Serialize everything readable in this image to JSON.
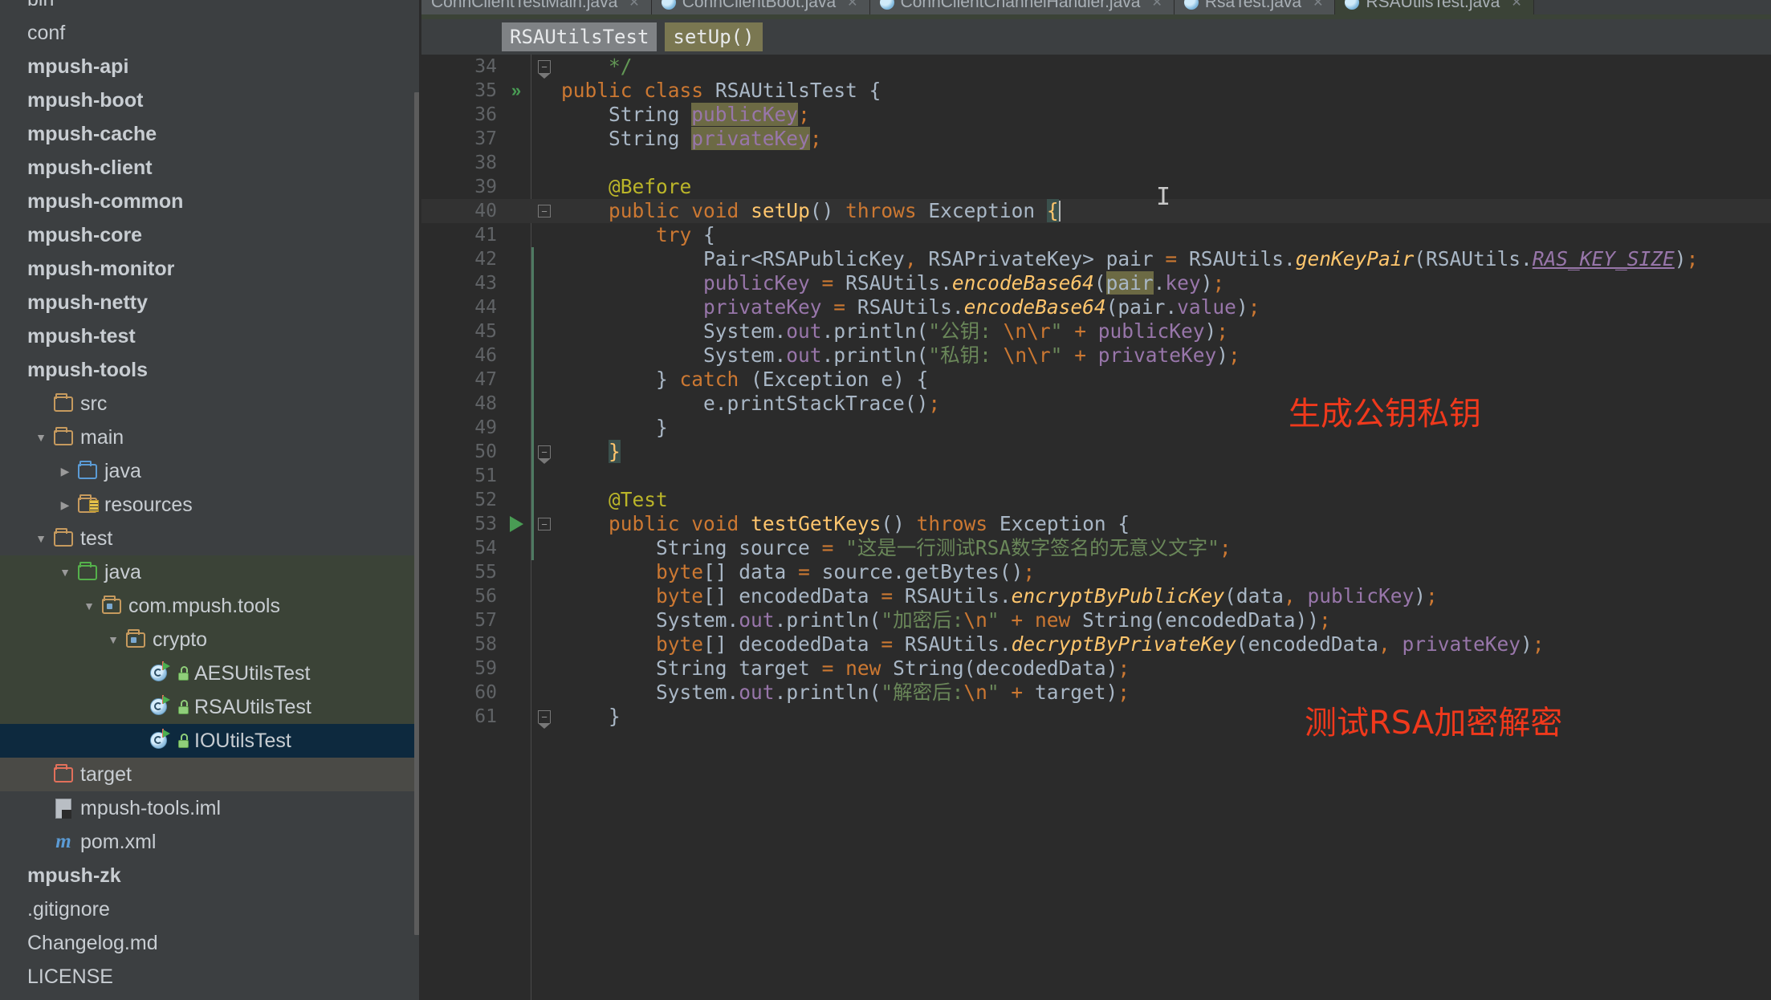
{
  "sidebar": {
    "items": [
      {
        "label": "bin",
        "indent": 0,
        "bold": false,
        "icon": "none",
        "twisty": "none",
        "sel": "none"
      },
      {
        "label": "conf",
        "indent": 0,
        "bold": false,
        "icon": "none",
        "twisty": "none",
        "sel": "none"
      },
      {
        "label": "mpush-api",
        "indent": 0,
        "bold": true,
        "icon": "none",
        "twisty": "none",
        "sel": "none"
      },
      {
        "label": "mpush-boot",
        "indent": 0,
        "bold": true,
        "icon": "none",
        "twisty": "none",
        "sel": "none"
      },
      {
        "label": "mpush-cache",
        "indent": 0,
        "bold": true,
        "icon": "none",
        "twisty": "none",
        "sel": "none"
      },
      {
        "label": "mpush-client",
        "indent": 0,
        "bold": true,
        "icon": "none",
        "twisty": "none",
        "sel": "none"
      },
      {
        "label": "mpush-common",
        "indent": 0,
        "bold": true,
        "icon": "none",
        "twisty": "none",
        "sel": "none"
      },
      {
        "label": "mpush-core",
        "indent": 0,
        "bold": true,
        "icon": "none",
        "twisty": "none",
        "sel": "none"
      },
      {
        "label": "mpush-monitor",
        "indent": 0,
        "bold": true,
        "icon": "none",
        "twisty": "none",
        "sel": "none"
      },
      {
        "label": "mpush-netty",
        "indent": 0,
        "bold": true,
        "icon": "none",
        "twisty": "none",
        "sel": "none"
      },
      {
        "label": "mpush-test",
        "indent": 0,
        "bold": true,
        "icon": "none",
        "twisty": "none",
        "sel": "none"
      },
      {
        "label": "mpush-tools",
        "indent": 0,
        "bold": true,
        "icon": "none",
        "twisty": "none",
        "sel": "none"
      },
      {
        "label": "src",
        "indent": 1,
        "bold": false,
        "icon": "folder",
        "twisty": "none",
        "sel": "none"
      },
      {
        "label": "main",
        "indent": 1,
        "bold": false,
        "icon": "folder",
        "twisty": "down",
        "sel": "none"
      },
      {
        "label": "java",
        "indent": 2,
        "bold": false,
        "icon": "folder-blue",
        "twisty": "right",
        "sel": "none"
      },
      {
        "label": "resources",
        "indent": 2,
        "bold": false,
        "icon": "folder-res",
        "twisty": "right",
        "sel": "none"
      },
      {
        "label": "test",
        "indent": 1,
        "bold": false,
        "icon": "folder",
        "twisty": "down",
        "sel": "none"
      },
      {
        "label": "java",
        "indent": 2,
        "bold": false,
        "icon": "folder-green",
        "twisty": "down",
        "sel": "green"
      },
      {
        "label": "com.mpush.tools",
        "indent": 3,
        "bold": false,
        "icon": "folder-pkg",
        "twisty": "down",
        "sel": "green"
      },
      {
        "label": "crypto",
        "indent": 4,
        "bold": false,
        "icon": "folder-pkg",
        "twisty": "down",
        "sel": "green"
      },
      {
        "label": "AESUtilsTest",
        "indent": 5,
        "bold": false,
        "icon": "test-class",
        "twisty": "none",
        "sel": "green"
      },
      {
        "label": "RSAUtilsTest",
        "indent": 5,
        "bold": false,
        "icon": "test-class",
        "twisty": "none",
        "sel": "green"
      },
      {
        "label": "IOUtilsTest",
        "indent": 5,
        "bold": false,
        "icon": "test-class",
        "twisty": "none",
        "sel": "blue"
      },
      {
        "label": "target",
        "indent": 1,
        "bold": false,
        "icon": "folder-red",
        "twisty": "none",
        "sel": "grey"
      },
      {
        "label": "mpush-tools.iml",
        "indent": 1,
        "bold": false,
        "icon": "file",
        "twisty": "none",
        "sel": "none"
      },
      {
        "label": "pom.xml",
        "indent": 1,
        "bold": false,
        "icon": "maven",
        "twisty": "none",
        "sel": "none"
      },
      {
        "label": "mpush-zk",
        "indent": 0,
        "bold": true,
        "icon": "none",
        "twisty": "none",
        "sel": "none"
      },
      {
        "label": ".gitignore",
        "indent": 0,
        "bold": false,
        "icon": "none",
        "twisty": "none",
        "sel": "none"
      },
      {
        "label": "Changelog.md",
        "indent": 0,
        "bold": false,
        "icon": "none",
        "twisty": "none",
        "sel": "none"
      },
      {
        "label": "LICENSE",
        "indent": 0,
        "bold": false,
        "icon": "none",
        "twisty": "none",
        "sel": "none"
      }
    ]
  },
  "tabs": [
    {
      "label": "ConnClientTestMain.java",
      "active": false
    },
    {
      "label": "ConnClientBoot.java",
      "active": false
    },
    {
      "label": "ConnClientChannelHandler.java",
      "active": false
    },
    {
      "label": "RsaTest.java",
      "active": false
    },
    {
      "label": "RSAUtilsTest.java",
      "active": true
    }
  ],
  "breadcrumb": {
    "class": "RSAUtilsTest",
    "method": "setUp()"
  },
  "editor": {
    "first_line": 34,
    "lines": [
      {
        "n": 34,
        "mark": "none",
        "fold": "pin-end",
        "current": false
      },
      {
        "n": 35,
        "mark": "run-double",
        "fold": "none",
        "current": false
      },
      {
        "n": 36,
        "mark": "none",
        "fold": "none",
        "current": false
      },
      {
        "n": 37,
        "mark": "none",
        "fold": "none",
        "current": false
      },
      {
        "n": 38,
        "mark": "none",
        "fold": "none",
        "current": false
      },
      {
        "n": 39,
        "mark": "none",
        "fold": "none",
        "current": false
      },
      {
        "n": 40,
        "mark": "none",
        "fold": "minus",
        "current": true
      },
      {
        "n": 41,
        "mark": "none",
        "fold": "none",
        "current": false
      },
      {
        "n": 42,
        "mark": "none",
        "fold": "none",
        "current": false
      },
      {
        "n": 43,
        "mark": "none",
        "fold": "none",
        "current": false
      },
      {
        "n": 44,
        "mark": "none",
        "fold": "none",
        "current": false
      },
      {
        "n": 45,
        "mark": "none",
        "fold": "none",
        "current": false
      },
      {
        "n": 46,
        "mark": "none",
        "fold": "none",
        "current": false
      },
      {
        "n": 47,
        "mark": "none",
        "fold": "none",
        "current": false
      },
      {
        "n": 48,
        "mark": "none",
        "fold": "none",
        "current": false
      },
      {
        "n": 49,
        "mark": "none",
        "fold": "none",
        "current": false
      },
      {
        "n": 50,
        "mark": "none",
        "fold": "pin-end",
        "current": false
      },
      {
        "n": 51,
        "mark": "none",
        "fold": "none",
        "current": false
      },
      {
        "n": 52,
        "mark": "none",
        "fold": "none",
        "current": false
      },
      {
        "n": 53,
        "mark": "run",
        "fold": "minus",
        "current": false
      },
      {
        "n": 54,
        "mark": "none",
        "fold": "none",
        "current": false
      },
      {
        "n": 55,
        "mark": "none",
        "fold": "none",
        "current": false
      },
      {
        "n": 56,
        "mark": "none",
        "fold": "none",
        "current": false
      },
      {
        "n": 57,
        "mark": "none",
        "fold": "none",
        "current": false
      },
      {
        "n": 58,
        "mark": "none",
        "fold": "none",
        "current": false
      },
      {
        "n": 59,
        "mark": "none",
        "fold": "none",
        "current": false
      },
      {
        "n": 60,
        "mark": "none",
        "fold": "none",
        "current": false
      },
      {
        "n": 61,
        "mark": "none",
        "fold": "pin-end",
        "current": false
      }
    ],
    "source": [
      "    */",
      "public class RSAUtilsTest {",
      "    String publicKey;",
      "    String privateKey;",
      "",
      "    @Before",
      "    public void setUp() throws Exception {",
      "        try {",
      "            Pair<RSAPublicKey, RSAPrivateKey> pair = RSAUtils.genKeyPair(RSAUtils.RAS_KEY_SIZE);",
      "            publicKey = RSAUtils.encodeBase64(pair.key);",
      "            privateKey = RSAUtils.encodeBase64(pair.value);",
      "            System.out.println(\"公钥: \\n\\r\" + publicKey);",
      "            System.out.println(\"私钥: \\n\\r\" + privateKey);",
      "        } catch (Exception e) {",
      "            e.printStackTrace();",
      "        }",
      "    }",
      "",
      "    @Test",
      "    public void testGetKeys() throws Exception {",
      "        String source = \"这是一行测试RSA数字签名的无意义文字\";",
      "        byte[] data = source.getBytes();",
      "        byte[] encodedData = RSAUtils.encryptByPublicKey(data, publicKey);",
      "        System.out.println(\"加密后:\\n\" + new String(encodedData));",
      "        byte[] decodedData = RSAUtils.decryptByPrivateKey(encodedData, privateKey);",
      "        String target = new String(decodedData);",
      "        System.out.println(\"解密后:\\n\" + target);",
      "    }"
    ]
  },
  "annotations": [
    {
      "text": "生成公钥私钥",
      "color": "#f0391c"
    },
    {
      "text": "测试RSA加密解密",
      "color": "#f0391c"
    }
  ]
}
